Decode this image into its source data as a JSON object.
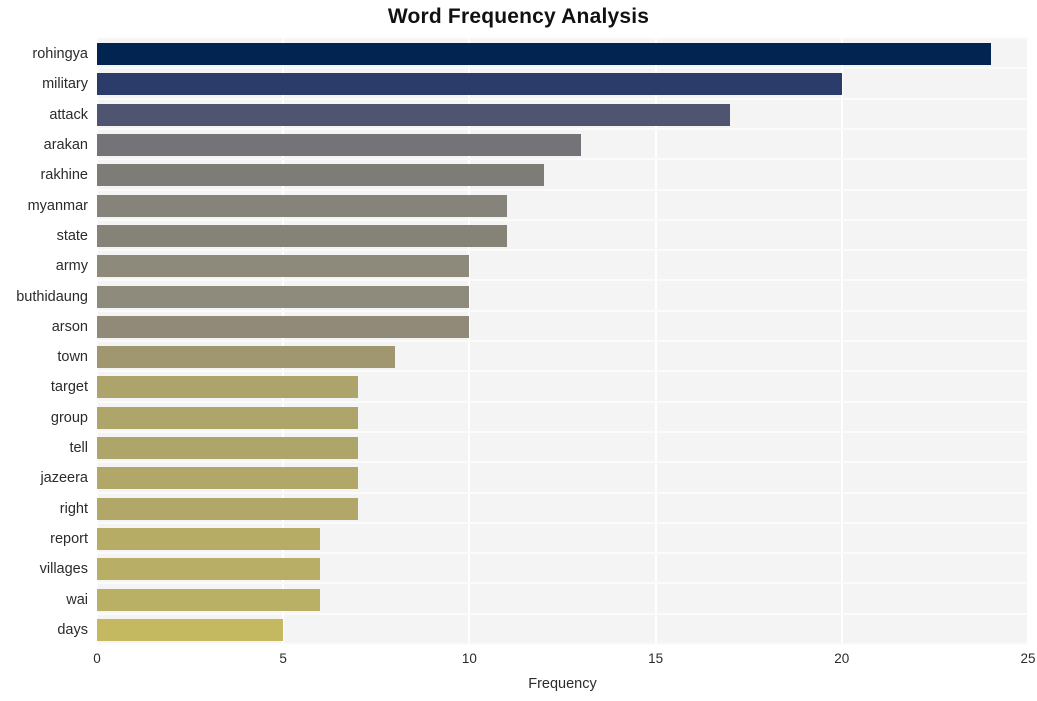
{
  "chart_data": {
    "type": "bar",
    "orientation": "horizontal",
    "title": "Word Frequency Analysis",
    "xlabel": "Frequency",
    "ylabel": "",
    "xlim": [
      0,
      25
    ],
    "xticks": [
      "0",
      "5",
      "10",
      "15",
      "20",
      "25"
    ],
    "grid": true,
    "legend": null,
    "categories": [
      "rohingya",
      "military",
      "attack",
      "arakan",
      "rakhine",
      "myanmar",
      "state",
      "army",
      "buthidaung",
      "arson",
      "town",
      "target",
      "group",
      "tell",
      "jazeera",
      "right",
      "report",
      "villages",
      "wai",
      "days"
    ],
    "values": [
      24,
      20,
      17,
      13,
      12,
      11,
      11,
      10,
      10,
      10,
      8,
      7,
      7,
      7,
      7,
      7,
      6,
      6,
      6,
      5
    ],
    "bar_colors": [
      "#022450",
      "#2b3c6b",
      "#4f5571",
      "#737378",
      "#7d7c76",
      "#85837a",
      "#858377",
      "#8d8a7c",
      "#8e8b7c",
      "#918a78",
      "#a09771",
      "#aca46b",
      "#aea56a",
      "#aea56a",
      "#b0a769",
      "#b0a769",
      "#b6ac66",
      "#b8ae65",
      "#bab065",
      "#c4b860"
    ]
  },
  "figure": {
    "background_color": "#ffffff",
    "plot_background_color": "#f4f4f5",
    "gridline_color": "#ffffff",
    "title_color": "#111111",
    "tick_label_color": "#2b2b2b"
  }
}
